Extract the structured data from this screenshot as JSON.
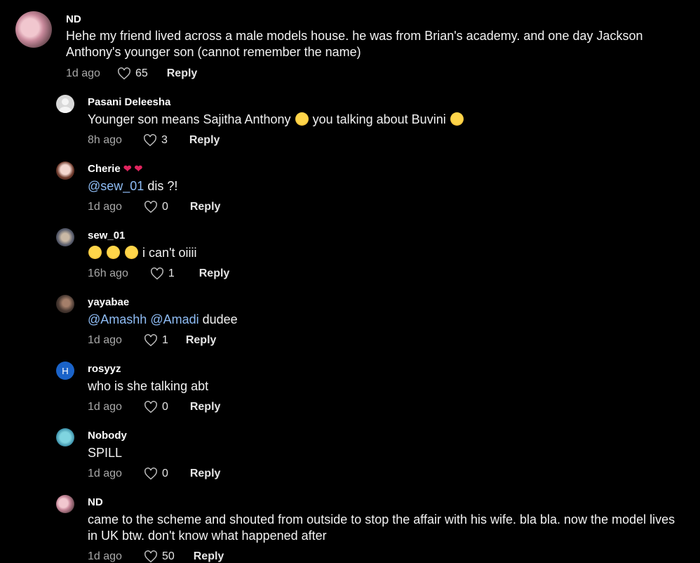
{
  "comments": [
    {
      "username": "ND",
      "text": "Hehe my friend lived across a male models house. he was from Brian's academy. and one day Jackson Anthony's younger son (cannot remember the name)",
      "time": "1d ago",
      "likes": "65",
      "reply": "Reply"
    },
    {
      "username": "Pasani Deleesha",
      "text_a": "Younger son means Sajitha Anthony",
      "text_b": "you talking about Buvini",
      "time": "8h ago",
      "likes": "3",
      "reply": "Reply"
    },
    {
      "username": "Cherie",
      "mention": "@sew_01",
      "text": " dis ?!",
      "time": "1d ago",
      "likes": "0",
      "reply": "Reply"
    },
    {
      "username": "sew_01",
      "text": "i can't oiiii",
      "time": "16h ago",
      "likes": "1",
      "reply": "Reply"
    },
    {
      "username": "yayabae",
      "mention1": "@Amashh",
      "mention2": "@Amadi",
      "text": " dudee",
      "time": "1d ago",
      "likes": "1",
      "reply": "Reply"
    },
    {
      "username": "rosyyz",
      "avatar_letter": "H",
      "text": "who is she talking abt",
      "time": "1d ago",
      "likes": "0",
      "reply": "Reply"
    },
    {
      "username": "Nobody",
      "text": "SPILL",
      "time": "1d ago",
      "likes": "0",
      "reply": "Reply"
    },
    {
      "username": "ND",
      "text": "came to the scheme and shouted from outside to stop the affair with his wife. bla bla. now the model lives in UK btw. don't know what happened after",
      "time": "1d ago",
      "likes": "50",
      "reply": "Reply"
    }
  ]
}
